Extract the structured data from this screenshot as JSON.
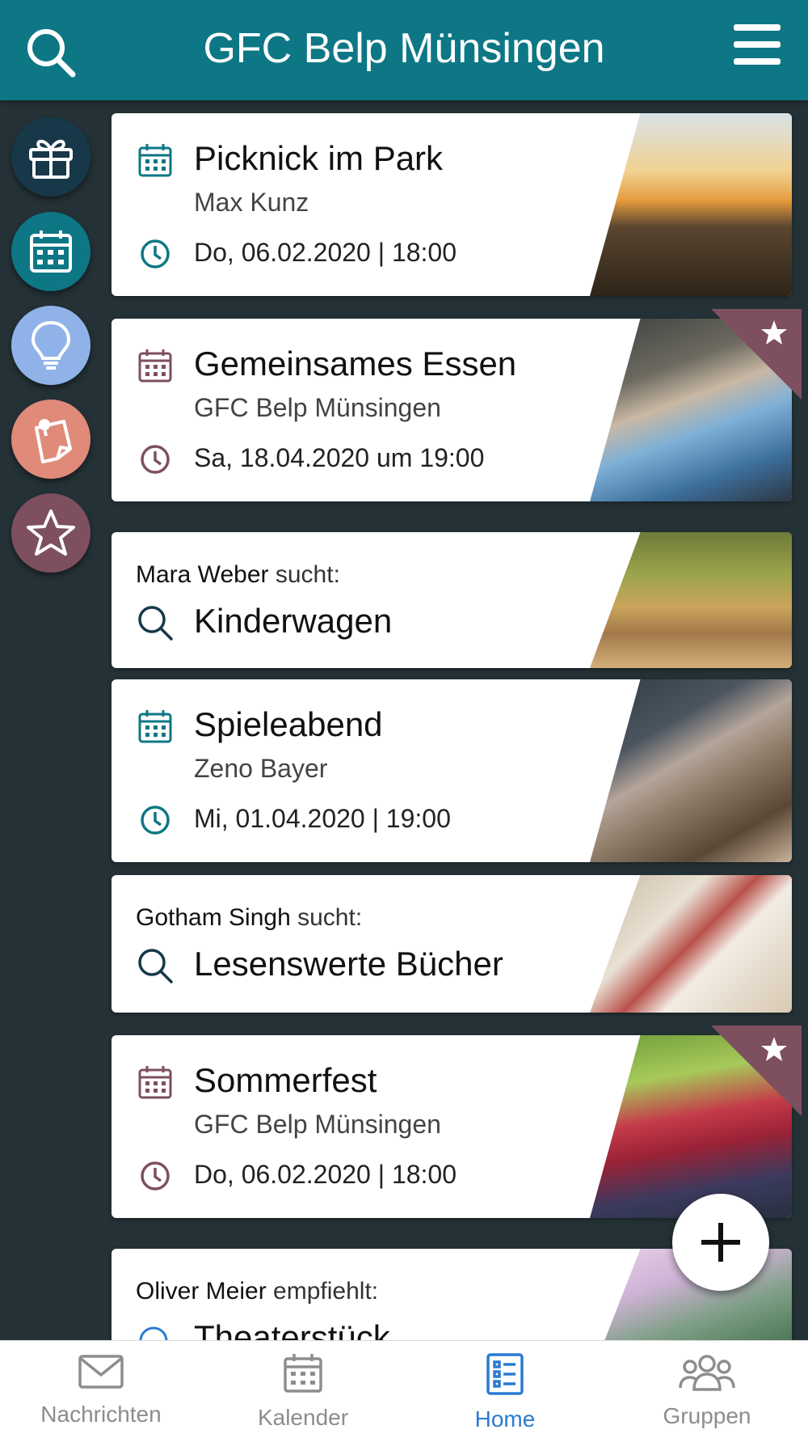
{
  "header": {
    "title": "GFC Belp Münsingen"
  },
  "side_buttons": [
    {
      "name": "gift",
      "color": "#173848"
    },
    {
      "name": "calendar",
      "color": "#0d7785"
    },
    {
      "name": "lightbulb",
      "color": "#8fb3e8"
    },
    {
      "name": "note",
      "color": "#e08a7a"
    },
    {
      "name": "star",
      "color": "#7d4f5f"
    }
  ],
  "cards": [
    {
      "type": "event",
      "title": "Picknick im Park",
      "organizer": "Max Kunz",
      "datetime": "Do, 06.02.2020 | 18:00",
      "accent": "#0d7785",
      "starred": false,
      "image": "park-sunset"
    },
    {
      "type": "event",
      "title": "Gemeinsames Essen",
      "organizer": "GFC Belp Münsingen",
      "datetime": "Sa, 18.04.2020 um 19:00",
      "accent": "#7d4f5f",
      "starred": true,
      "image": "woman-cafe"
    },
    {
      "type": "search",
      "author": "Mara Weber",
      "verb": "sucht:",
      "title": "Kinderwagen",
      "image": "family-park"
    },
    {
      "type": "event",
      "title": "Spieleabend",
      "organizer": "Zeno Bayer",
      "datetime": "Mi, 01.04.2020 | 19:00",
      "accent": "#0d7785",
      "starred": false,
      "image": "chess-game"
    },
    {
      "type": "search",
      "author": "Gotham Singh",
      "verb": "sucht:",
      "title": "Lesenswerte Bücher",
      "image": "open-book"
    },
    {
      "type": "event",
      "title": "Sommerfest",
      "organizer": "GFC Belp Münsingen",
      "datetime": "Do, 06.02.2020 | 18:00",
      "accent": "#7d4f5f",
      "starred": true,
      "image": "berries"
    },
    {
      "type": "recommend",
      "author": "Oliver Meier",
      "verb": "empfiehlt:",
      "title": "Theaterstück",
      "image": "succulent"
    }
  ],
  "tabs": [
    {
      "label": "Nachrichten",
      "icon": "mail-icon",
      "active": false
    },
    {
      "label": "Kalender",
      "icon": "calendar-icon",
      "active": false
    },
    {
      "label": "Home",
      "icon": "list-icon",
      "active": true
    },
    {
      "label": "Gruppen",
      "icon": "group-icon",
      "active": false
    }
  ],
  "colors": {
    "header": "#0d7785",
    "background": "#243237",
    "active_tab": "#2a7bd1",
    "inactive_tab": "#8d8d8d"
  }
}
